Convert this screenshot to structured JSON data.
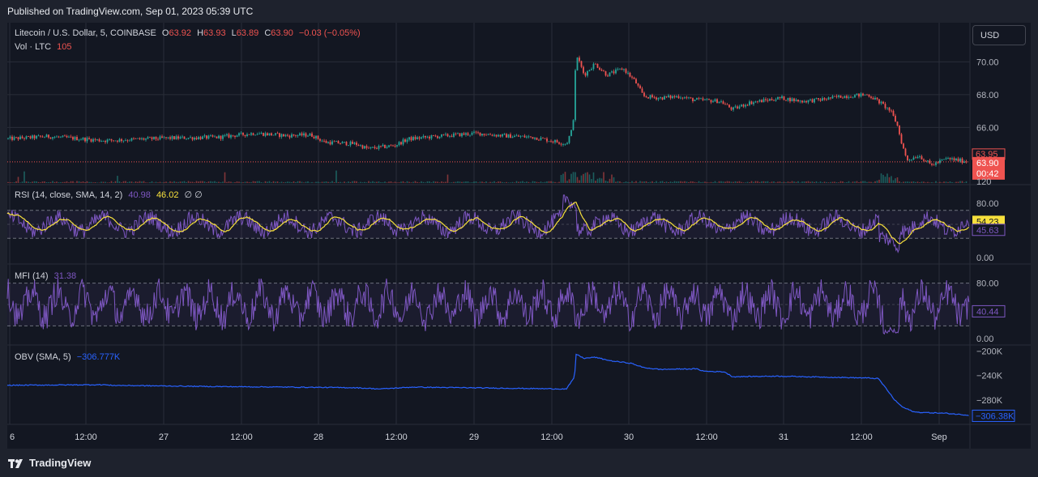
{
  "header": {
    "published": "Published on TradingView.com, Sep 01, 2023 05:39 UTC"
  },
  "currency_button": "USD",
  "legend": {
    "symbol": "Litecoin / U.S. Dollar, 5, COINBASE",
    "o_label": "O",
    "o_value": "63.92",
    "h_label": "H",
    "h_value": "63.93",
    "l_label": "L",
    "l_value": "63.89",
    "c_label": "C",
    "c_value": "63.90",
    "change": "−0.03 (−0.05%)",
    "vol_label": "Vol · LTC",
    "vol_value": "105",
    "rsi_label": "RSI (14, close, SMA, 14, 2)",
    "rsi_value": "40.98",
    "rsi_ma_value": "46.02",
    "rsi_extra": "∅  ∅",
    "mfi_label": "MFI (14)",
    "mfi_value": "31.38",
    "obv_label": "OBV (SMA, 5)",
    "obv_value": "−306.777K"
  },
  "footer": {
    "brand": "TradingView"
  },
  "colors": {
    "bg": "#131722",
    "up": "#26a69a",
    "down": "#ef5350",
    "rsi": "#7e57c2",
    "rsi_ma": "#f7e03c",
    "obv": "#2962ff",
    "grid": "#2a2e39"
  },
  "chart_data": [
    {
      "type": "candlestick",
      "title": "Litecoin / U.S. Dollar, 5, COINBASE",
      "x_ticks": [
        "6",
        "12:00",
        "27",
        "12:00",
        "28",
        "12:00",
        "29",
        "12:00",
        "30",
        "12:00",
        "31",
        "12:00",
        "Sep"
      ],
      "y_ticks": [
        "70.00",
        "68.00",
        "66.00"
      ],
      "ylim": [
        63.3,
        71.8
      ],
      "last_price": 63.9,
      "last_price_label": "63.90",
      "countdown_label": "00:42",
      "marker_label": "63.95",
      "volume_axis_label": "120",
      "keypoints": [
        [
          0,
          65.3
        ],
        [
          50,
          65.45
        ],
        [
          120,
          65.2
        ],
        [
          200,
          65.35
        ],
        [
          260,
          65.4
        ],
        [
          305,
          65.65
        ],
        [
          345,
          65.5
        ],
        [
          375,
          65.55
        ],
        [
          392,
          65.1
        ],
        [
          430,
          65.0
        ],
        [
          445,
          64.7
        ],
        [
          478,
          64.9
        ],
        [
          495,
          65.3
        ],
        [
          530,
          65.45
        ],
        [
          580,
          65.65
        ],
        [
          610,
          65.5
        ],
        [
          650,
          65.4
        ],
        [
          690,
          65.0
        ],
        [
          698,
          66.0
        ],
        [
          702,
          70.5
        ],
        [
          712,
          69.2
        ],
        [
          725,
          69.9
        ],
        [
          740,
          69.2
        ],
        [
          760,
          69.6
        ],
        [
          775,
          68.8
        ],
        [
          785,
          67.9
        ],
        [
          805,
          67.8
        ],
        [
          830,
          67.9
        ],
        [
          845,
          67.7
        ],
        [
          880,
          67.6
        ],
        [
          895,
          67.1
        ],
        [
          915,
          67.5
        ],
        [
          955,
          67.8
        ],
        [
          980,
          67.6
        ],
        [
          1005,
          67.7
        ],
        [
          1030,
          67.9
        ],
        [
          1062,
          68.0
        ],
        [
          1075,
          67.6
        ],
        [
          1090,
          67.0
        ],
        [
          1098,
          66.2
        ],
        [
          1103,
          65.2
        ],
        [
          1110,
          64.0
        ],
        [
          1125,
          64.3
        ],
        [
          1140,
          63.7
        ],
        [
          1160,
          64.1
        ],
        [
          1180,
          63.95
        ],
        [
          1195,
          63.9
        ]
      ]
    },
    {
      "type": "line",
      "title": "RSI (14, close, SMA, 14, 2)",
      "y_ticks": [
        "80.00",
        "0.00"
      ],
      "ylim": [
        0,
        100
      ],
      "bands": [
        70,
        50,
        30
      ],
      "series": [
        {
          "name": "RSI",
          "last": 45.63,
          "last_label": "45.63"
        },
        {
          "name": "MA",
          "last": 54.23,
          "last_label": "54.23"
        }
      ]
    },
    {
      "type": "line",
      "title": "MFI (14)",
      "y_ticks": [
        "80.00",
        "0.00"
      ],
      "ylim": [
        0,
        100
      ],
      "bands": [
        80,
        50,
        20
      ],
      "series": [
        {
          "name": "MFI",
          "last": 40.44,
          "last_label": "40.44"
        }
      ]
    },
    {
      "type": "line",
      "title": "OBV (SMA, 5)",
      "y_ticks": [
        "−200K",
        "−240K",
        "−280K"
      ],
      "ylim": [
        -320000,
        -190000
      ],
      "last_label": "−306.38K",
      "keypoints": [
        [
          0,
          -256000
        ],
        [
          120,
          -255000
        ],
        [
          125,
          -256000
        ],
        [
          250,
          -258000
        ],
        [
          350,
          -259000
        ],
        [
          430,
          -260000
        ],
        [
          460,
          -262000
        ],
        [
          500,
          -259000
        ],
        [
          690,
          -262000
        ],
        [
          700,
          -243000
        ],
        [
          702,
          -205000
        ],
        [
          712,
          -212000
        ],
        [
          725,
          -210000
        ],
        [
          745,
          -216000
        ],
        [
          770,
          -220000
        ],
        [
          785,
          -227000
        ],
        [
          805,
          -230000
        ],
        [
          850,
          -229000
        ],
        [
          860,
          -233000
        ],
        [
          885,
          -234000
        ],
        [
          895,
          -242000
        ],
        [
          950,
          -241000
        ],
        [
          1060,
          -244000
        ],
        [
          1075,
          -245000
        ],
        [
          1085,
          -262000
        ],
        [
          1095,
          -280000
        ],
        [
          1105,
          -292000
        ],
        [
          1120,
          -300000
        ],
        [
          1160,
          -302000
        ],
        [
          1195,
          -306000
        ]
      ]
    }
  ]
}
